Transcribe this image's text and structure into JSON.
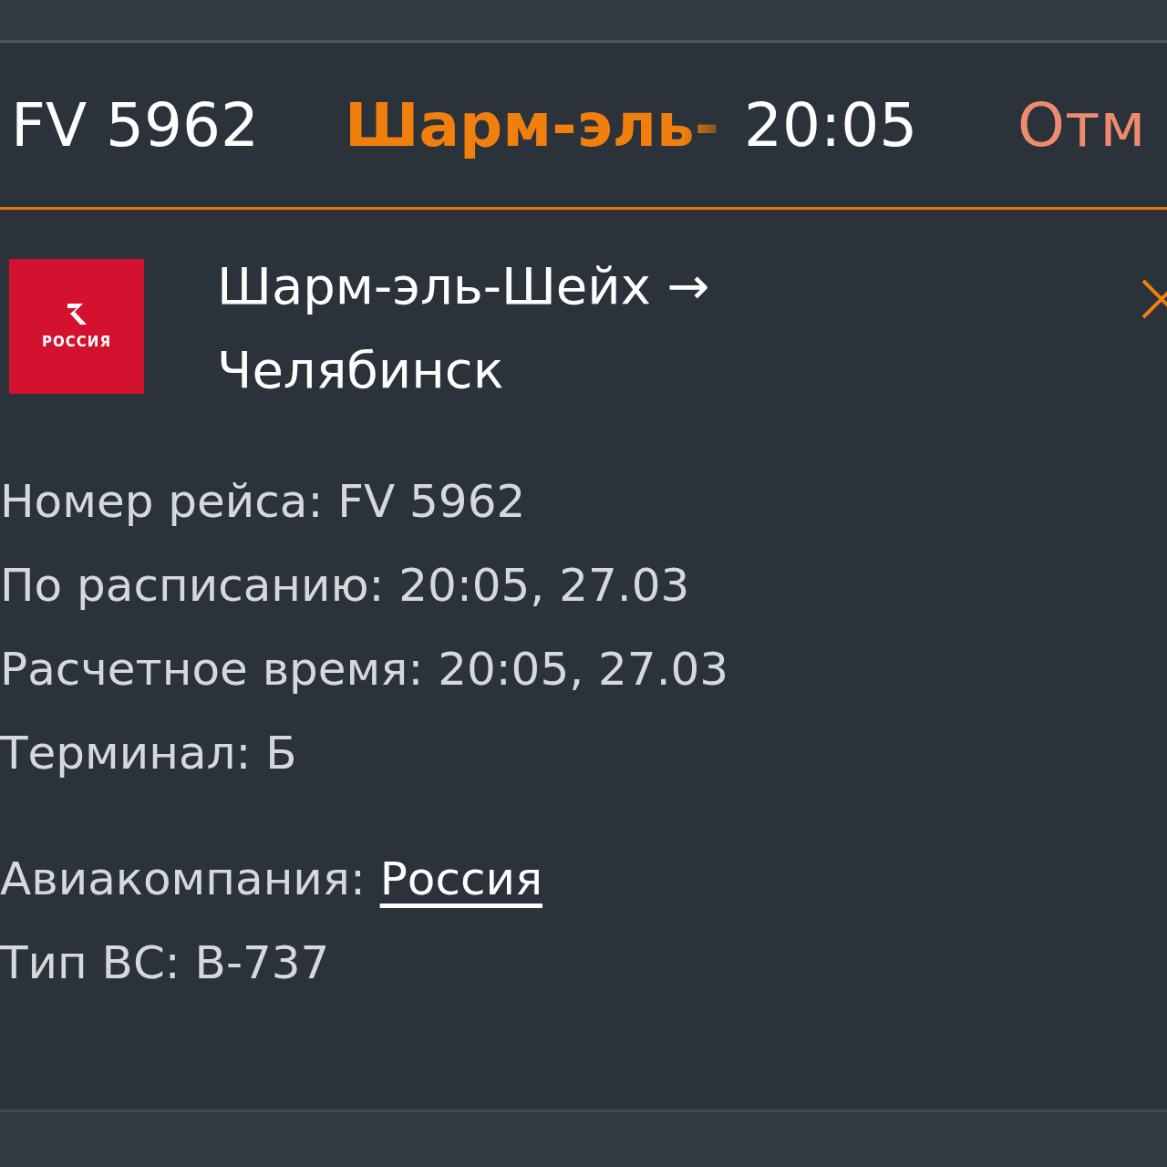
{
  "flight_row": {
    "flight": "FV 5962",
    "destination": "Шарм-эль-",
    "time": "20:05",
    "status": "Отм",
    "expanded": true
  },
  "details": {
    "logo_text": "РОССИЯ",
    "route_from": "Шарм-эль-Шейх →",
    "route_to": "Челябинск",
    "lines": [
      {
        "text": "Номер рейса: FV 5962"
      },
      {
        "text": "По расписанию: 20:05, 27.03"
      },
      {
        "text": "Расчетное время: 20:05, 27.03"
      },
      {
        "text": "Терминал: Б"
      }
    ],
    "airline_label": "Авиакомпания:",
    "airline_link": "Россия",
    "aircraft": "Тип ВС: B-737"
  }
}
